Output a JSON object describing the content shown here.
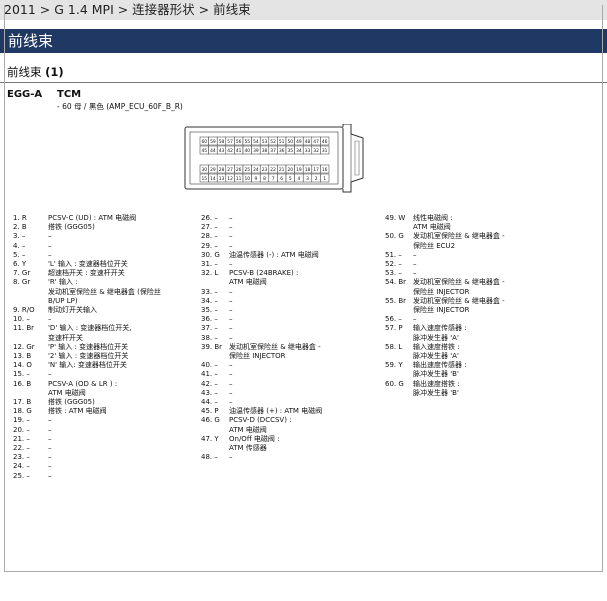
{
  "breadcrumb": "2011 > G 1.4 MPI > 连接器形状 > 前线束",
  "page_title": "前线束",
  "section": {
    "name": "前线束",
    "index": "(1)"
  },
  "connector": {
    "id": "EGG-A",
    "name": "TCM",
    "description": "- 60 母 / 黑色 (AMP_ECU_60F_B_R)"
  },
  "diagram_rows": [
    [
      "60",
      "59",
      "58",
      "57",
      "56",
      "55",
      "54",
      "53",
      "52",
      "51",
      "50",
      "49",
      "48",
      "47",
      "46"
    ],
    [
      "45",
      "44",
      "43",
      "42",
      "41",
      "40",
      "39",
      "38",
      "37",
      "36",
      "35",
      "34",
      "33",
      "32",
      "31"
    ],
    [
      "30",
      "29",
      "28",
      "27",
      "26",
      "25",
      "24",
      "23",
      "22",
      "21",
      "20",
      "19",
      "18",
      "17",
      "16"
    ],
    [
      "15",
      "14",
      "13",
      "12",
      "11",
      "10",
      "9",
      "8",
      "7",
      "6",
      "5",
      "4",
      "3",
      "2",
      "1"
    ]
  ],
  "columns": [
    [
      {
        "n": "1. R",
        "t": [
          "PCSV-C (UD) : ATM 电磁阀"
        ]
      },
      {
        "n": "2. B",
        "t": [
          "搭铁 (GGG05)"
        ]
      },
      {
        "n": "3. –",
        "t": [
          "–"
        ]
      },
      {
        "n": "4. –",
        "t": [
          "–"
        ]
      },
      {
        "n": "5. –",
        "t": [
          "–"
        ]
      },
      {
        "n": "6. Y",
        "t": [
          "'L' 输入 : 变速器档位开关"
        ]
      },
      {
        "n": "7. Gr",
        "t": [
          "超速档开关 : 变速杆开关"
        ]
      },
      {
        "n": "8. Gr",
        "t": [
          "'R' 输入 :",
          "发动机室保险丝 & 继电器盒 (保险丝",
          " B/UP LP)"
        ]
      },
      {
        "n": "9. R/O",
        "t": [
          "制动灯开关输入"
        ]
      },
      {
        "n": "10. –",
        "t": [
          "–"
        ]
      },
      {
        "n": "11. Br",
        "t": [
          "'D' 输入 : 变速器档位开关,",
          "变速杆开关"
        ]
      },
      {
        "n": "12. Gr",
        "t": [
          "'P' 输入 : 变速器档位开关"
        ]
      },
      {
        "n": "13. B",
        "t": [
          "'2' 输入 : 变速器档位开关"
        ]
      },
      {
        "n": "14. O",
        "t": [
          "'N' 输入: 变速器档位开关"
        ]
      },
      {
        "n": "15. –",
        "t": [
          "–"
        ]
      },
      {
        "n": "16. B",
        "t": [
          "PCSV-A (OD & LR ) :",
          "ATM 电磁阀"
        ]
      },
      {
        "n": "17. B",
        "t": [
          "搭铁 (GGG05)"
        ]
      },
      {
        "n": "18. G",
        "t": [
          "搭铁 : ATM 电磁阀"
        ]
      },
      {
        "n": "19. –",
        "t": [
          "–"
        ]
      },
      {
        "n": "20. –",
        "t": [
          "–"
        ]
      },
      {
        "n": "21. –",
        "t": [
          "–"
        ]
      },
      {
        "n": "22. –",
        "t": [
          "–"
        ]
      },
      {
        "n": "23. –",
        "t": [
          "–"
        ]
      },
      {
        "n": "24. –",
        "t": [
          "–"
        ]
      },
      {
        "n": "25. –",
        "t": [
          "–"
        ]
      }
    ],
    [
      {
        "n": "26. –",
        "t": [
          "–"
        ]
      },
      {
        "n": "27. –",
        "t": [
          "–"
        ]
      },
      {
        "n": "28. –",
        "t": [
          "–"
        ]
      },
      {
        "n": "29. –",
        "t": [
          "–"
        ]
      },
      {
        "n": "30. G",
        "t": [
          "油温传感器 (-) : ATM 电磁阀"
        ]
      },
      {
        "n": "31. –",
        "t": [
          "–"
        ]
      },
      {
        "n": "32. L",
        "t": [
          "PCSV-B (24BRAKE) :",
          "ATM 电磁阀"
        ]
      },
      {
        "n": "33. –",
        "t": [
          "–"
        ]
      },
      {
        "n": "34. –",
        "t": [
          "–"
        ]
      },
      {
        "n": "35. –",
        "t": [
          "–"
        ]
      },
      {
        "n": "36. –",
        "t": [
          "–"
        ]
      },
      {
        "n": "37. –",
        "t": [
          "–"
        ]
      },
      {
        "n": "38. –",
        "t": [
          "–"
        ]
      },
      {
        "n": "39. Br",
        "t": [
          "发动机室保险丝 & 继电器盒 -",
          "保险丝 INJECTOR"
        ]
      },
      {
        "n": "40. –",
        "t": [
          "–"
        ]
      },
      {
        "n": "41. –",
        "t": [
          "–"
        ]
      },
      {
        "n": "42. –",
        "t": [
          "–"
        ]
      },
      {
        "n": "43. –",
        "t": [
          "–"
        ]
      },
      {
        "n": "44. –",
        "t": [
          "–"
        ]
      },
      {
        "n": "45. P",
        "t": [
          "油温传感器 (+) : ATM 电磁阀"
        ]
      },
      {
        "n": "46. G",
        "t": [
          "PCSV-D (DCCSV) :",
          "ATM 电磁阀"
        ]
      },
      {
        "n": "47. Y",
        "t": [
          "On/Off 电磁阀 :",
          "ATM 传感器"
        ]
      },
      {
        "n": "48. –",
        "t": [
          "–"
        ]
      }
    ],
    [
      {
        "n": "49. W",
        "t": [
          "线性电磁阀 :",
          "ATM 电磁阀"
        ]
      },
      {
        "n": "50. G",
        "t": [
          "发动机室保险丝 & 继电器盒 -",
          "保险丝 ECU2"
        ]
      },
      {
        "n": "51. –",
        "t": [
          "–"
        ]
      },
      {
        "n": "52. –",
        "t": [
          "–"
        ]
      },
      {
        "n": "53. –",
        "t": [
          "–"
        ]
      },
      {
        "n": "54. Br",
        "t": [
          "发动机室保险丝 & 继电器盒 -",
          "保险丝 INJECTOR"
        ]
      },
      {
        "n": "55. Br",
        "t": [
          "发动机室保险丝 & 继电器盒 -",
          "保险丝 INJECTOR"
        ]
      },
      {
        "n": "56. –",
        "t": [
          "–"
        ]
      },
      {
        "n": "57. P",
        "t": [
          "输入速度传感器 :",
          "脉冲发生器 'A'"
        ]
      },
      {
        "n": "58. L",
        "t": [
          "输入速度搭铁 :",
          "脉冲发生器 'A'"
        ]
      },
      {
        "n": "59. Y",
        "t": [
          "输出速度传感器 :",
          "脉冲发生器 'B'"
        ]
      },
      {
        "n": "60. G",
        "t": [
          "输出速度搭铁 :",
          "脉冲发生器 'B'"
        ]
      }
    ]
  ]
}
